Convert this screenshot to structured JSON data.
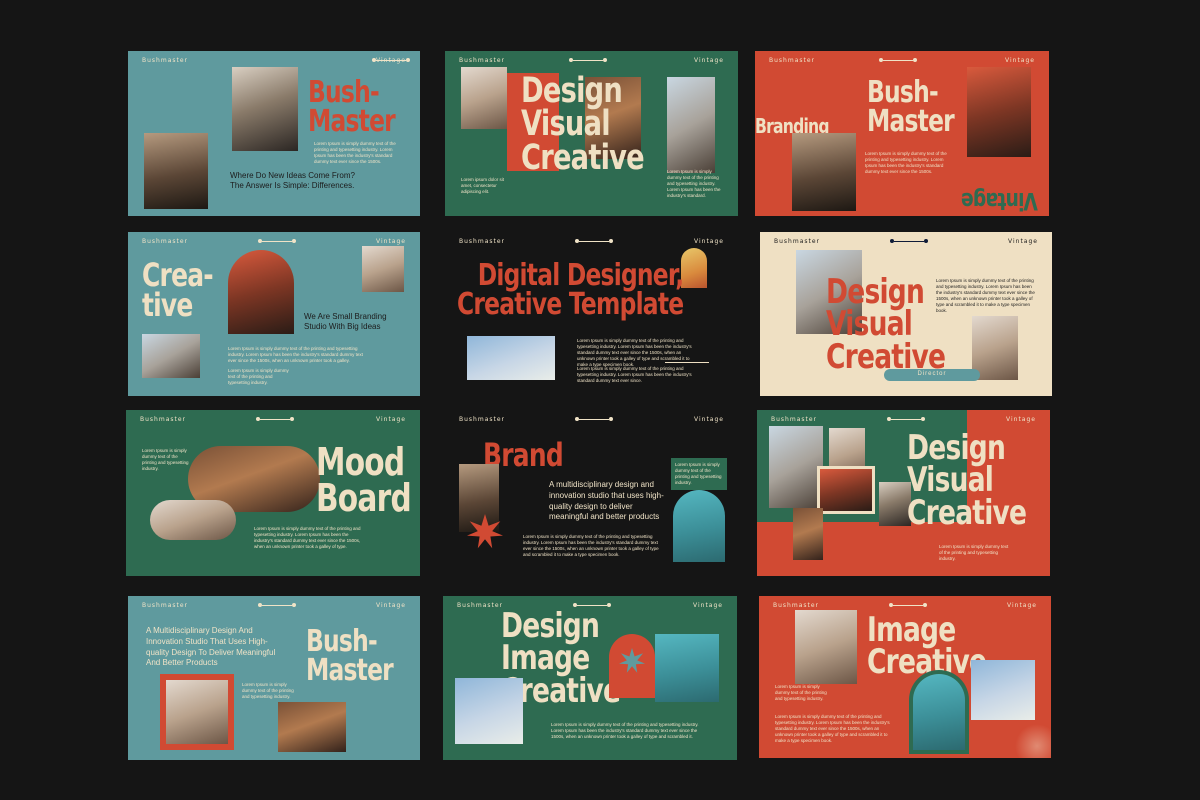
{
  "brand": "Bushmaster",
  "tag": "Vintage",
  "slides": {
    "s1": {
      "title": "Bush-\nMaster",
      "body": "Lorem Ipsum is simply dummy text of the printing and typesetting industry. Lorem Ipsum has been the industry's standard dummy text ever since the 1500s.",
      "tagline": "Where Do New Ideas Come From?\nThe Answer Is Simple: Differences."
    },
    "s2": {
      "title": "Design\nVisual\nCreative",
      "body": "Lorem Ipsum is simply dummy text of the printing and typesetting industry. Lorem Ipsum has been the industry's standard.",
      "caption": "Lorem ipsum dolor sit amet, consectetur adipiscing elit."
    },
    "s3": {
      "title": "Bush-\nMaster",
      "branding": "Branding",
      "vintage": "Vintage",
      "body": "Lorem Ipsum is simply dummy text of the printing and typesetting industry. Lorem Ipsum has been the industry's standard dummy text ever since the 1500s."
    },
    "s4": {
      "title": "Crea-\ntive",
      "tagline": "We Are Small Branding\nStudio With Big Ideas",
      "body": "Lorem Ipsum is simply dummy text of the printing and typesetting industry. Lorem Ipsum has been the industry's standard dummy text ever since the 1500s, when an unknown printer took a galley.",
      "body2": "Lorem Ipsum is simply dummy text of the printing and typesetting industry."
    },
    "s5": {
      "title": "Digital Designer,\nCreative Template",
      "body": "Lorem Ipsum is simply dummy text of the printing and typesetting industry. Lorem Ipsum has been the industry's standard dummy text ever since the 1500s, when an unknown printer took a galley of type and scrambled it to make a type specimen book.",
      "body2": "Lorem Ipsum is simply dummy text of the printing and typesetting industry. Lorem Ipsum has been the industry's standard dummy text ever since."
    },
    "s6": {
      "title": "Design\nVisual\nCreative",
      "badge": "Director",
      "body": "Lorem Ipsum is simply dummy text of the printing and typesetting industry. Lorem Ipsum has been the industry's standard dummy text ever since the 1500s, when an unknown printer took a galley of type and scrambled it to make a type specimen book."
    },
    "s7": {
      "title": "Mood\nBoard",
      "body": "Lorem Ipsum is simply dummy text of the printing and typesetting industry.",
      "body2": "Lorem Ipsum is simply dummy text of the printing and typesetting industry. Lorem Ipsum has been the industry's standard dummy text ever since the 1500s, when an unknown printer took a galley of type."
    },
    "s8": {
      "title": "Brand",
      "tagline": "A multidisciplinary design and innovation studio that uses high-quality design to deliver meaningful and better products",
      "box": "Lorem Ipsum is simply dummy text of the printing and typesetting industry.",
      "body": "Lorem Ipsum is simply dummy text of the printing and typesetting industry. Lorem Ipsum has been the industry's standard dummy text ever since the 1500s, when an unknown printer took a galley of type and scrambled it to make a type specimen book."
    },
    "s9": {
      "title": "Design\nVisual\nCreative",
      "body": "Lorem Ipsum is simply dummy text of the printing and typesetting industry."
    },
    "s10": {
      "title": "Bush-\nMaster",
      "tagline": "A Multidisciplinary Design And Innovation Studio That Uses High-quality Design To Deliver Meaningful And Better Products",
      "body": "Lorem Ipsum is simply dummy text of the printing and typesetting industry."
    },
    "s11": {
      "title": "Design\nImage\nCreative",
      "body": "Lorem Ipsum is simply dummy text of the printing and typesetting industry. Lorem Ipsum has been the industry's standard dummy text ever since the 1500s, when an unknown printer took a galley of type and scrambled it."
    },
    "s12": {
      "title": "Image\nCreative",
      "body": "Lorem Ipsum is simply dummy text of the printing and typesetting industry.",
      "body2": "Lorem Ipsum is simply dummy text of the printing and typesetting industry. Lorem Ipsum has been the industry's standard dummy text ever since the 1500s, when an unknown printer took a galley of type and scrambled it to make a type specimen book."
    }
  }
}
